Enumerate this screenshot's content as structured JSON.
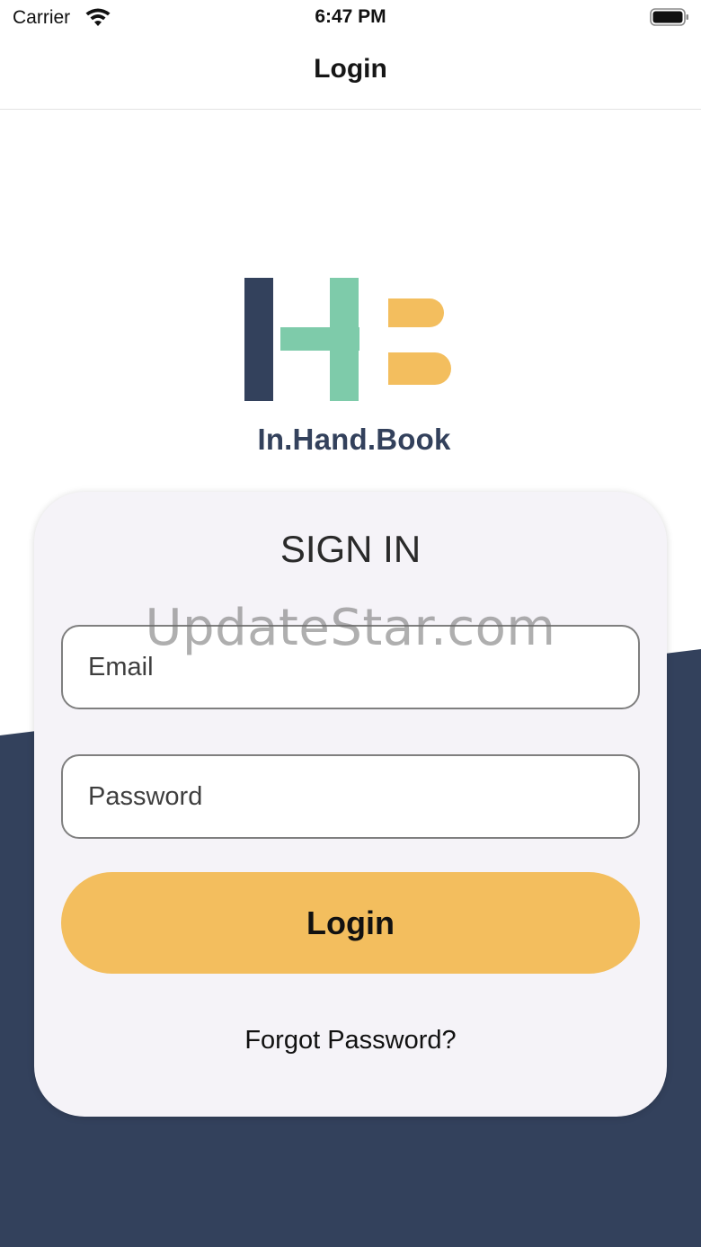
{
  "status_bar": {
    "carrier": "Carrier",
    "time": "6:47 PM",
    "icons": [
      "wifi-icon",
      "battery-icon"
    ]
  },
  "nav": {
    "title": "Login"
  },
  "logo": {
    "monogram": "HB",
    "brand_name": "In.Hand.Book",
    "colors": {
      "navy": "#33415c",
      "mint": "#7ecbaa",
      "gold": "#f3be5e"
    }
  },
  "card": {
    "title": "SIGN IN",
    "email": {
      "placeholder": "Email",
      "value": ""
    },
    "password": {
      "placeholder": "Password",
      "value": ""
    },
    "login_label": "Login",
    "forgot_label": "Forgot Password?"
  },
  "watermark": "UpdateStar.com",
  "colors": {
    "background_navy": "#33415c",
    "card_background": "#f5f3f8",
    "button_gold": "#f3be5e"
  }
}
